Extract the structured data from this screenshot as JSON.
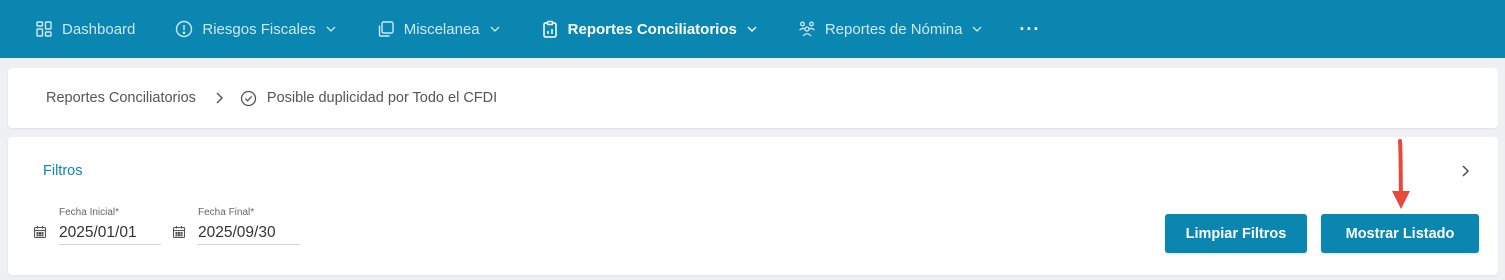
{
  "nav": {
    "items": [
      {
        "label": "Dashboard",
        "icon": "dashboard-grid-icon",
        "has_chevron": false,
        "active": false
      },
      {
        "label": "Riesgos Fiscales",
        "icon": "alert-circle-icon",
        "has_chevron": true,
        "active": false
      },
      {
        "label": "Miscelanea",
        "icon": "copy-icon",
        "has_chevron": true,
        "active": false
      },
      {
        "label": "Reportes Conciliatorios",
        "icon": "clipboard-icon",
        "has_chevron": true,
        "active": true
      },
      {
        "label": "Reportes de Nómina",
        "icon": "users-icon",
        "has_chevron": true,
        "active": false
      }
    ],
    "more_label": "···"
  },
  "breadcrumb": {
    "parent": "Reportes Conciliatorios",
    "current": "Posible duplicidad por Todo el CFDI"
  },
  "filters": {
    "title": "Filtros",
    "fecha_inicial": {
      "label": "Fecha Inicial*",
      "value": "2025/01/01"
    },
    "fecha_final": {
      "label": "Fecha Final*",
      "value": "2025/09/30"
    },
    "clear_button": "Limpiar Filtros",
    "show_button": "Mostrar Listado"
  },
  "colors": {
    "nav_bg": "#0a86b0",
    "accent": "#0a86b0",
    "annotation_arrow": "#e8493a"
  }
}
